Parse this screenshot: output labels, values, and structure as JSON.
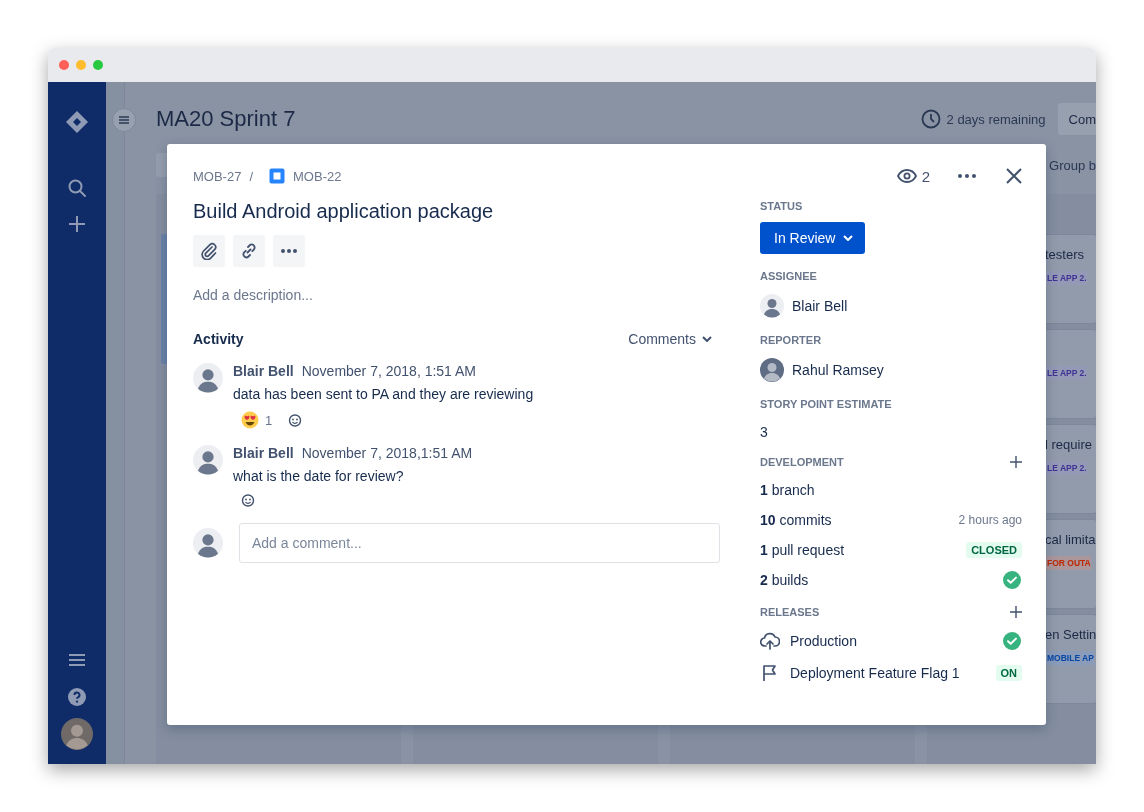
{
  "board": {
    "title": "MA20 Sprint 7",
    "time_remaining": "2 days remaining",
    "complete_button": "Com",
    "group_by": "Group b",
    "cards": [
      {
        "title": "testers",
        "tag": "LE APP 2.",
        "color": "#403294"
      },
      {
        "tag": "LE APP 2.",
        "color": "#403294"
      },
      {
        "title": "l require",
        "tag": "LE APP 2.",
        "color": "#403294"
      },
      {
        "title": "cal limita",
        "tag": "FOR OUTA",
        "color": "#bf2600"
      },
      {
        "title": "en Settin",
        "tag": "MOBILE AP",
        "color": "#0747a6"
      }
    ]
  },
  "issue": {
    "parent_key": "MOB-27",
    "separator": "/",
    "key": "MOB-22",
    "title": "Build Android application package",
    "watchers": "2",
    "description_placeholder": "Add a description...",
    "activity": {
      "heading": "Activity",
      "filter": "Comments",
      "comments": [
        {
          "author": "Blair Bell",
          "time": "November 7, 2018, 1:51 AM",
          "text": "data has been sent to PA and they are reviewing",
          "reactions": [
            {
              "count": "1"
            }
          ]
        },
        {
          "author": "Blair Bell",
          "time": "November 7, 2018,1:51 AM",
          "text": "what is the date for review?"
        }
      ],
      "comment_placeholder": "Add a comment..."
    }
  },
  "details": {
    "status": {
      "label": "STATUS",
      "value": "In Review"
    },
    "assignee": {
      "label": "ASSIGNEE",
      "name": "Blair Bell"
    },
    "reporter": {
      "label": "REPORTER",
      "name": "Rahul Ramsey"
    },
    "story_points": {
      "label": "STORY POINT ESTIMATE",
      "value": "3"
    },
    "development": {
      "label": "DEVELOPMENT",
      "items": [
        {
          "text": "**1** branch"
        },
        {
          "text": "**10** commits",
          "meta": "2 hours ago"
        },
        {
          "text": "**1** pull request",
          "badge": "CLOSED"
        },
        {
          "text": "**2** builds",
          "passed": true
        }
      ]
    },
    "releases": {
      "label": "RELEASES",
      "items": [
        {
          "kind": "deployment",
          "name": "Production",
          "passed": true
        },
        {
          "kind": "feature-flag",
          "name": "Deployment Feature Flag 1",
          "badge": "ON"
        }
      ]
    }
  }
}
